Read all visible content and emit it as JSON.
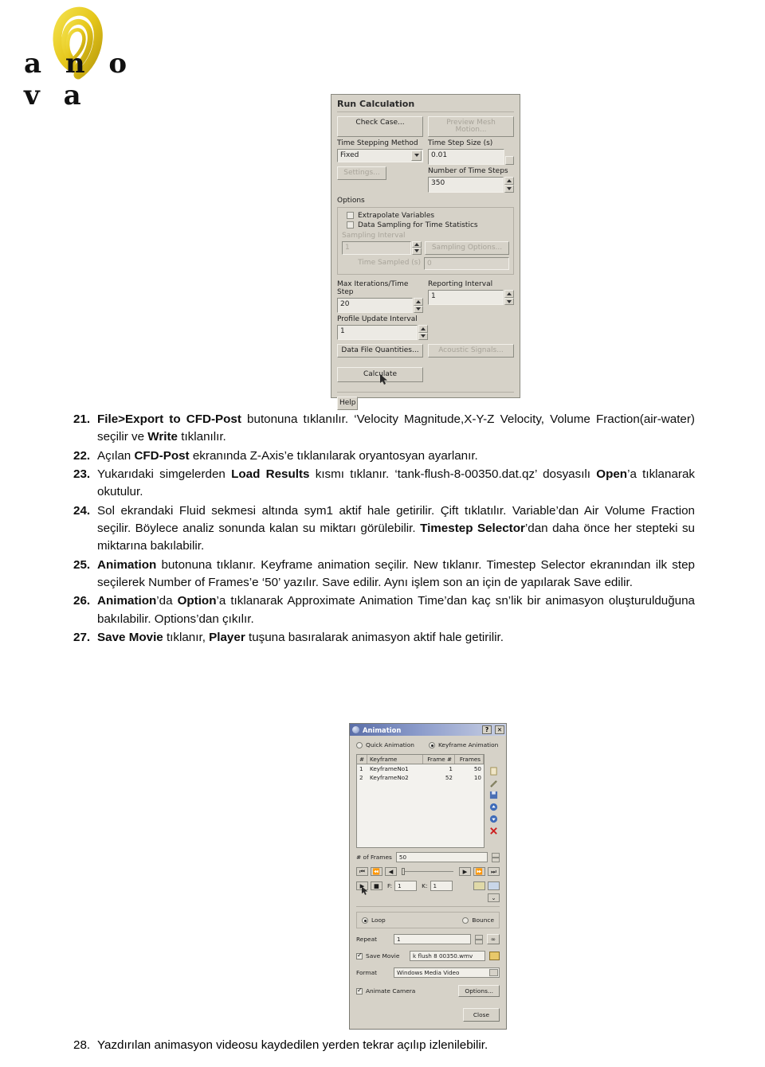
{
  "logo": {
    "wordmark": "a n o v a",
    "accent_color": "#e8c81e"
  },
  "run_calculation": {
    "title": "Run Calculation",
    "check_case_button": "Check Case...",
    "preview_mesh_button": "Preview Mesh Motion...",
    "time_stepping_label": "Time Stepping Method",
    "time_stepping_value": "Fixed",
    "settings_button": "Settings...",
    "time_step_size_label": "Time Step Size (s)",
    "time_step_size_value": "0.01",
    "number_of_time_steps_label": "Number of Time Steps",
    "number_of_time_steps_value": "350",
    "options_label": "Options",
    "extrapolate_label": "Extrapolate Variables",
    "data_sampling_label": "Data Sampling for Time Statistics",
    "sampling_interval_label": "Sampling Interval",
    "sampling_interval_value": "1",
    "sampling_options_button": "Sampling Options...",
    "time_sampled_label": "Time Sampled (s)",
    "time_sampled_value": "0",
    "max_iterations_label": "Max Iterations/Time Step",
    "max_iterations_value": "20",
    "reporting_interval_label": "Reporting Interval",
    "reporting_interval_value": "1",
    "profile_update_label": "Profile Update Interval",
    "profile_update_value": "1",
    "data_file_quantities_button": "Data File Quantities...",
    "acoustic_signals_button": "Acoustic Signals...",
    "calculate_button": "Calculate",
    "help_button": "Help"
  },
  "steps": [
    {
      "number": "21.",
      "html": "<b>File&gt;Export to CFD-Post</b> butonuna tıklanılır. ‘Velocity Magnitude,X-Y-Z Velocity, Volume Fraction(air-water) seçilir ve <b>Write</b> tıklanılır."
    },
    {
      "number": "22.",
      "html": "Açılan <b>CFD-Post</b> ekranında Z-Axis’e tıklanılarak oryantosyan ayarlanır."
    },
    {
      "number": "23.",
      "html": "Yukarıdaki simgelerden <b>Load Results</b> kısmı tıklanır. ‘tank-flush-8-00350.dat.qz’ dosyasılı <b>Open</b>’a tıklanarak okutulur."
    },
    {
      "number": "24.",
      "html": "Sol ekrandaki Fluid sekmesi altında sym1 aktif hale getirilir. Çift tıklatılır. Variable’dan Air Volume Fraction seçilir. Böylece analiz sonunda kalan su miktarı görülebilir. <b>Timestep Selector</b>’dan daha önce her stepteki su miktarına bakılabilir."
    },
    {
      "number": "25.",
      "html": "<b>Animation</b> butonuna tıklanır. Keyframe animation seçilir. New tıklanır. Timestep Selector ekranından ilk step seçilerek Number of Frames’e ‘50’ yazılır. Save edilir. Aynı işlem son an için de yapılarak Save edilir."
    },
    {
      "number": "26.",
      "html": "<b>Animation</b>’da <b>Option</b>’a tıklanarak Approximate Animation Time’dan kaç sn’lik bir animasyon oluşturulduğuna bakılabilir. Options’dan çıkılır."
    },
    {
      "number": "27.",
      "html": "<b>Save Movie</b> tıklanır, <b>Player</b> tuşuna basıralarak animasyon aktif hale getirilir."
    }
  ],
  "final_step": {
    "number": "28.",
    "text": "Yazdırılan animasyon videosu kaydedilen yerden tekrar açılıp izlenilebilir."
  },
  "animation_dialog": {
    "title": "Animation",
    "help_button": "?",
    "close_button": "✕",
    "quick_animation_label": "Quick Animation",
    "keyframe_animation_label": "Keyframe Animation",
    "selected_mode": "Keyframe Animation",
    "table": {
      "headers": [
        "#",
        "Keyframe",
        "Frame #",
        "Frames"
      ],
      "rows": [
        [
          "1",
          "KeyframeNo1",
          "1",
          "50"
        ],
        [
          "2",
          "KeyframeNo2",
          "52",
          "10"
        ]
      ]
    },
    "side_icons": [
      "new-keyframe-icon",
      "edit-keyframe-icon",
      "save-keyframe-icon",
      "move-up-icon",
      "move-down-icon",
      "delete-keyframe-icon"
    ],
    "num_frames_label": "# of Frames",
    "num_frames_value": "50",
    "frame_label": "F:",
    "frame_value": "1",
    "keyframe_label": "K:",
    "keyframe_value": "1",
    "loop_label": "Loop",
    "bounce_label": "Bounce",
    "selected_playback": "Loop",
    "repeat_label": "Repeat",
    "repeat_value": "1",
    "repeat_infinite": "∞",
    "save_movie_label": "Save Movie",
    "save_movie_checked": true,
    "save_movie_filename": "k flush 8 00350.wmv",
    "format_label": "Format",
    "format_value": "Windows Media Video",
    "animate_camera_label": "Animate Camera",
    "animate_camera_checked": true,
    "options_button": "Options...",
    "close_label": "Close"
  }
}
